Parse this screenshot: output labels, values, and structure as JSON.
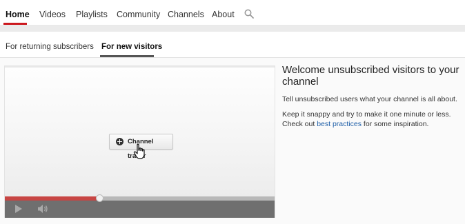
{
  "nav": {
    "items": [
      {
        "label": "Home",
        "active": true
      },
      {
        "label": "Videos",
        "active": false
      },
      {
        "label": "Playlists",
        "active": false
      },
      {
        "label": "Community",
        "active": false
      },
      {
        "label": "Channels",
        "active": false
      },
      {
        "label": "About",
        "active": false
      }
    ],
    "search_icon": "search-icon",
    "accent_color": "#cc181e"
  },
  "subtabs": {
    "items": [
      {
        "label": "For returning subscribers",
        "active": false
      },
      {
        "label": "For new visitors",
        "active": true
      }
    ]
  },
  "player": {
    "trailer_button_label": "Channel trailer",
    "progress_fraction": 0.35,
    "progress_color": "#c74543"
  },
  "info": {
    "title": "Welcome unsubscribed visitors to your channel",
    "line1": "Tell unsubscribed users what your channel is all about.",
    "line2": "Keep it snappy and try to make it one minute or less.",
    "line3_prefix": "Check out",
    "line3_link": "best practices",
    "line3_suffix": "for some inspiration.",
    "link_color": "#1f5fa8"
  }
}
